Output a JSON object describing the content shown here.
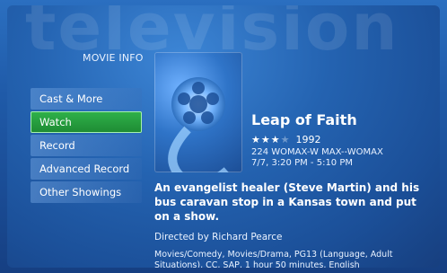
{
  "background_word": "television",
  "header": {
    "title": "MOVIE INFO"
  },
  "menu": {
    "items": [
      {
        "label": "Cast & More"
      },
      {
        "label": "Watch"
      },
      {
        "label": "Record"
      },
      {
        "label": "Advanced Record"
      },
      {
        "label": "Other Showings"
      }
    ],
    "selected_index": 1
  },
  "movie": {
    "poster_icon": "film-reel-icon",
    "title": "Leap of Faith",
    "rating_stars": 2.5,
    "rating_max": 4,
    "year": "1992",
    "channel": "224 WOMAX-W MAX--WOMAX",
    "time": "7/7, 3:20 PM - 5:10 PM",
    "description": "An evangelist healer (Steve Martin) and his bus caravan stop in a Kansas town and put on a show.",
    "director": "Directed by Richard Pearce",
    "details": "Movies/Comedy, Movies/Drama, PG13 (Language, Adult Situations), CC, SAP, 1 hour 50 minutes, English"
  },
  "colors": {
    "background": "#1f5aa8",
    "selection": "#2fb24a",
    "text": "#ffffff"
  }
}
